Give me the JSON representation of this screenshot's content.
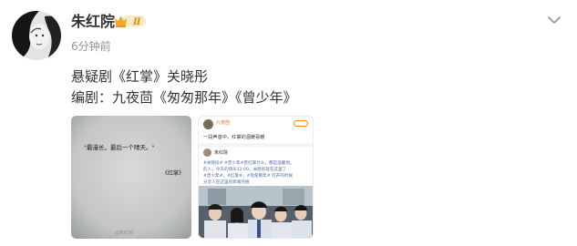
{
  "post": {
    "author": "朱红院",
    "timestamp": "6分钟前",
    "badge": "Ⅱ",
    "text_line1": "悬疑剧《红掌》关晓彤",
    "text_line2": "编剧：九夜茴《匆匆那年》《曾少年》"
  },
  "images": [
    {
      "text_main": "\"最漫长，最后一个晴天。\"",
      "text_side": "《红掌》",
      "watermark": "@朱红院"
    },
    {
      "header_name": "九夜茴",
      "first_line": "一段声音中，红掌的温暖喜暖",
      "comment_author": "朱红院",
      "comment_lines": [
        "#关晓彤# #曾少年#曾红掌什么，都是温暖地。",
        "的人，今天的快乐12:00，关晓彤就在这里了",
        "#曾少年#，#红掌#，#匆匆那年# 打开的时候",
        "分享人在这里的新闻热搜"
      ]
    }
  ],
  "colors": {
    "username": "#333333",
    "timestamp": "#939393",
    "badge_bg": "#f5a623",
    "link": "#4a6ea9"
  },
  "icons": [
    "chevron-down-icon",
    "crown-badge-icon"
  ]
}
